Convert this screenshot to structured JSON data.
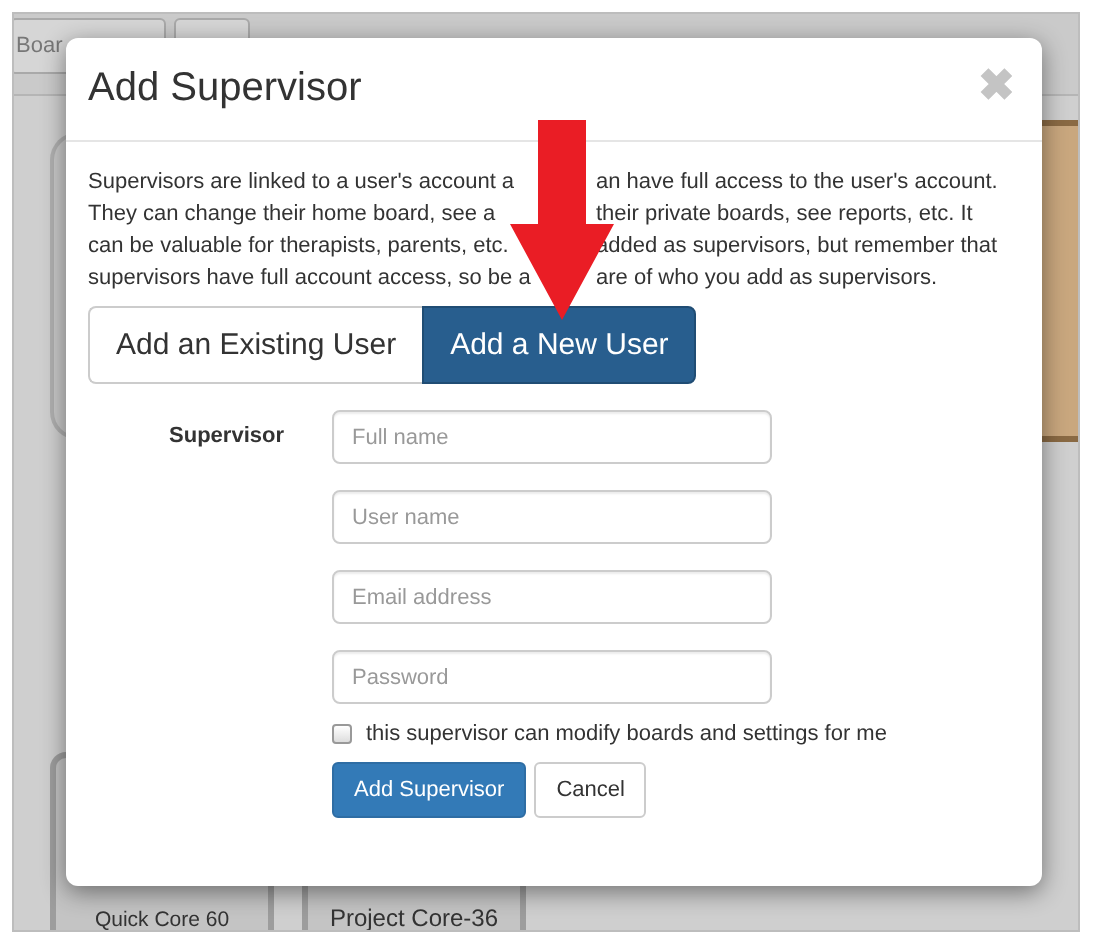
{
  "background": {
    "tab": "Boar",
    "tiles": [
      {
        "label": "Quick Core 60"
      },
      {
        "label": "Project Core-36"
      }
    ]
  },
  "dialog": {
    "title": "Add Supervisor",
    "close": "✖",
    "description_lines": [
      {
        "left": "Supervisors are linked to a user's account a",
        "right": "an have full access to the user's account."
      },
      {
        "left": "They can change their home board, see a",
        "right": "their private boards, see reports, etc. It"
      },
      {
        "left": "can be valuable for therapists, parents, etc.",
        "right": "added as supervisors, but remember that"
      },
      {
        "left": "supervisors have full account access, so be a",
        "right": "are of who you add as supervisors."
      }
    ],
    "tabs": [
      {
        "label": "Add an Existing User",
        "selected": false
      },
      {
        "label": "Add a New User",
        "selected": true
      }
    ],
    "form": {
      "label": "Supervisor",
      "fields": [
        {
          "placeholder": "Full name"
        },
        {
          "placeholder": "User name"
        },
        {
          "placeholder": "Email address"
        },
        {
          "placeholder": "Password"
        }
      ],
      "checkbox": {
        "label": "this supervisor can modify boards and settings for me",
        "checked": false
      }
    },
    "buttons": [
      {
        "label": "Add Supervisor",
        "kind": "primary"
      },
      {
        "label": "Cancel",
        "kind": "default"
      }
    ]
  }
}
